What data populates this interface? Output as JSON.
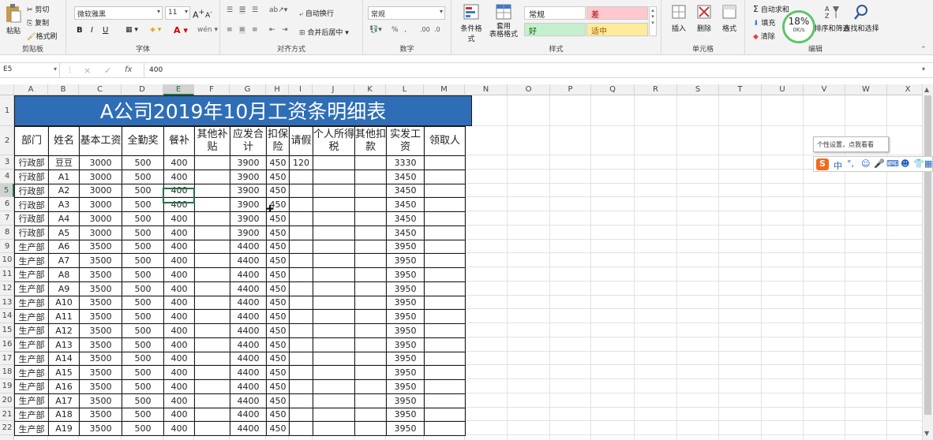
{
  "ribbon": {
    "clipboard": {
      "paste": "粘贴",
      "cut": "剪切",
      "copy": "复制",
      "painter": "格式刷",
      "label": "剪贴板"
    },
    "font": {
      "name": "微软雅黑",
      "size": "11",
      "bold": "B",
      "italic": "I",
      "underline": "U",
      "label": "字体"
    },
    "alignment": {
      "wrap": "自动换行",
      "merge": "合并后居中",
      "label": "对齐方式"
    },
    "number": {
      "format": "常规",
      "label": "数字"
    },
    "styles": {
      "cond": "条件格式",
      "table_line1": "套用",
      "table_line2": "表格格式",
      "normal": "常规",
      "bad": "差",
      "good": "好",
      "neutral": "适中",
      "label": "样式"
    },
    "cells": {
      "insert": "插入",
      "delete": "删除",
      "format": "格式",
      "label": "单元格"
    },
    "editing": {
      "autosum": "自动求和",
      "fill": "填充",
      "clear": "清除",
      "sort": "排序和筛选",
      "find": "查找和选择",
      "label": "编辑"
    },
    "speed": {
      "percent": "18%",
      "rate": "0K/s"
    }
  },
  "formula_bar": {
    "cell_ref": "E5",
    "value": "400",
    "cancel": "×",
    "enter": "✓",
    "fx": "fx"
  },
  "columns": [
    "A",
    "B",
    "C",
    "D",
    "E",
    "F",
    "G",
    "H",
    "I",
    "J",
    "K",
    "L",
    "M",
    "N",
    "O",
    "P",
    "Q",
    "R",
    "S",
    "T",
    "U",
    "V",
    "W",
    "X"
  ],
  "rows": [
    "1",
    "2",
    "3",
    "4",
    "5",
    "6",
    "7",
    "8",
    "9",
    "10",
    "11",
    "12",
    "13",
    "14",
    "15",
    "16",
    "17",
    "18",
    "19",
    "20",
    "21",
    "22"
  ],
  "sheet": {
    "title": "A公司2019年10月工资条明细表",
    "headers": [
      "部门",
      "姓名",
      "基本工资",
      "全勤奖",
      "餐补",
      "其他补贴",
      "应发合计",
      "扣保险",
      "请假",
      "个人所得税",
      "其他扣款",
      "实发工资",
      "领取人"
    ],
    "data": [
      [
        "行政部",
        "豆豆",
        "3000",
        "500",
        "400",
        "",
        "3900",
        "450",
        "120",
        "",
        "",
        "3330",
        ""
      ],
      [
        "行政部",
        "A1",
        "3000",
        "500",
        "400",
        "",
        "3900",
        "450",
        "",
        "",
        "",
        "3450",
        ""
      ],
      [
        "行政部",
        "A2",
        "3000",
        "500",
        "400",
        "",
        "3900",
        "450",
        "",
        "",
        "",
        "3450",
        ""
      ],
      [
        "行政部",
        "A3",
        "3000",
        "500",
        "400",
        "",
        "3900",
        "450",
        "",
        "",
        "",
        "3450",
        ""
      ],
      [
        "行政部",
        "A4",
        "3000",
        "500",
        "400",
        "",
        "3900",
        "450",
        "",
        "",
        "",
        "3450",
        ""
      ],
      [
        "行政部",
        "A5",
        "3000",
        "500",
        "400",
        "",
        "3900",
        "450",
        "",
        "",
        "",
        "3450",
        ""
      ],
      [
        "生产部",
        "A6",
        "3500",
        "500",
        "400",
        "",
        "4400",
        "450",
        "",
        "",
        "",
        "3950",
        ""
      ],
      [
        "生产部",
        "A7",
        "3500",
        "500",
        "400",
        "",
        "4400",
        "450",
        "",
        "",
        "",
        "3950",
        ""
      ],
      [
        "生产部",
        "A8",
        "3500",
        "500",
        "400",
        "",
        "4400",
        "450",
        "",
        "",
        "",
        "3950",
        ""
      ],
      [
        "生产部",
        "A9",
        "3500",
        "500",
        "400",
        "",
        "4400",
        "450",
        "",
        "",
        "",
        "3950",
        ""
      ],
      [
        "生产部",
        "A10",
        "3500",
        "500",
        "400",
        "",
        "4400",
        "450",
        "",
        "",
        "",
        "3950",
        ""
      ],
      [
        "生产部",
        "A11",
        "3500",
        "500",
        "400",
        "",
        "4400",
        "450",
        "",
        "",
        "",
        "3950",
        ""
      ],
      [
        "生产部",
        "A12",
        "3500",
        "500",
        "400",
        "",
        "4400",
        "450",
        "",
        "",
        "",
        "3950",
        ""
      ],
      [
        "生产部",
        "A13",
        "3500",
        "500",
        "400",
        "",
        "4400",
        "450",
        "",
        "",
        "",
        "3950",
        ""
      ],
      [
        "生产部",
        "A14",
        "3500",
        "500",
        "400",
        "",
        "4400",
        "450",
        "",
        "",
        "",
        "3950",
        ""
      ],
      [
        "生产部",
        "A15",
        "3500",
        "500",
        "400",
        "",
        "4400",
        "450",
        "",
        "",
        "",
        "3950",
        ""
      ],
      [
        "生产部",
        "A16",
        "3500",
        "500",
        "400",
        "",
        "4400",
        "450",
        "",
        "",
        "",
        "3950",
        ""
      ],
      [
        "生产部",
        "A17",
        "3500",
        "500",
        "400",
        "",
        "4400",
        "450",
        "",
        "",
        "",
        "3950",
        ""
      ],
      [
        "生产部",
        "A18",
        "3500",
        "500",
        "400",
        "",
        "4400",
        "450",
        "",
        "",
        "",
        "3950",
        ""
      ],
      [
        "生产部",
        "A19",
        "3500",
        "500",
        "400",
        "",
        "4400",
        "450",
        "",
        "",
        "",
        "3950",
        ""
      ]
    ]
  },
  "tooltip": "个性设置，点我看看",
  "ime": {
    "logo": "S",
    "mode": "中"
  }
}
